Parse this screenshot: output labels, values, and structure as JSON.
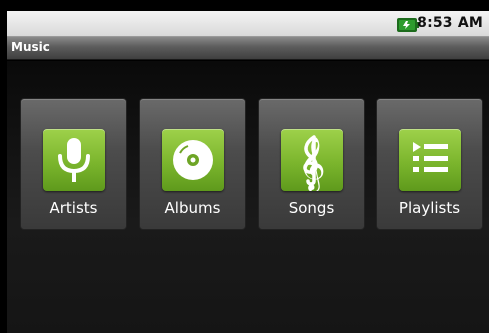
{
  "status_bar": {
    "time": "8:53 AM",
    "battery_icon": "battery-charging-icon"
  },
  "title_bar": {
    "title": "Music"
  },
  "tiles": [
    {
      "label": "Artists",
      "icon": "microphone-icon"
    },
    {
      "label": "Albums",
      "icon": "disc-icon"
    },
    {
      "label": "Songs",
      "icon": "treble-clef-icon"
    },
    {
      "label": "Playlists",
      "icon": "playlist-icon"
    }
  ],
  "colors": {
    "icon_green": "#7bb52d",
    "tile_gray": "#4c4c4c",
    "background": "#000000"
  }
}
